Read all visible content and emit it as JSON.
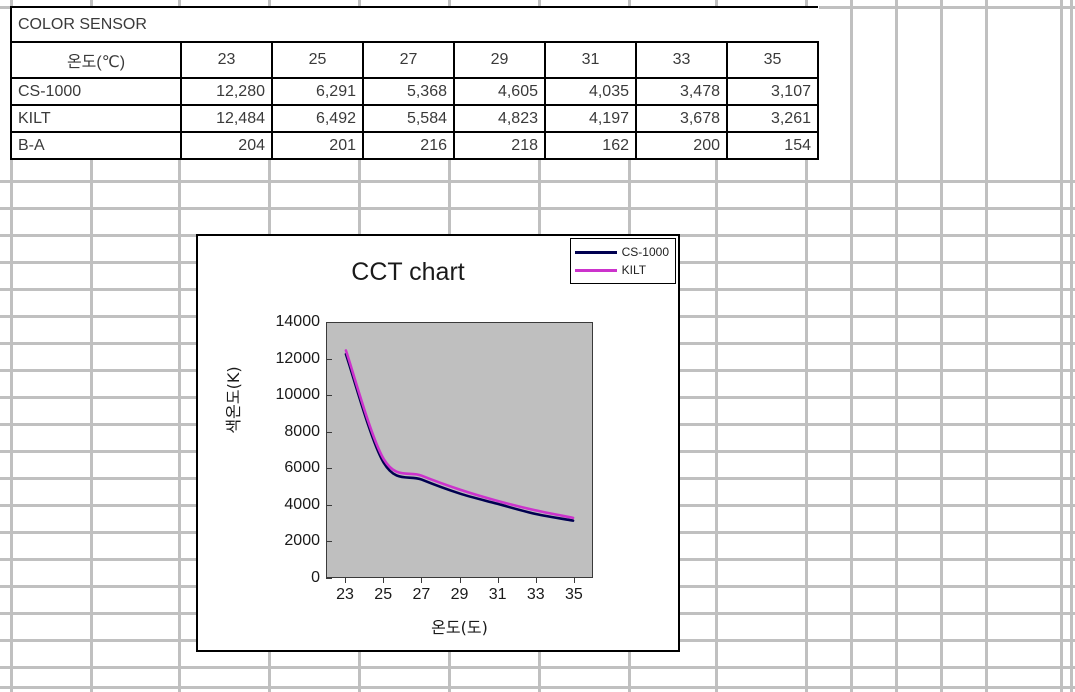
{
  "sheet": {
    "column_edges": [
      10,
      90,
      178,
      268,
      358,
      448,
      538,
      628,
      715,
      805,
      850,
      895,
      940,
      985,
      1060,
      1070
    ],
    "row_edges": [
      6,
      180,
      207,
      234,
      261,
      288,
      315,
      342,
      369,
      396,
      423,
      450,
      477,
      504,
      531,
      558,
      585,
      612,
      639,
      666,
      686
    ],
    "gridline_color": "#c0c0c0"
  },
  "table": {
    "title": "COLOR SENSOR",
    "header_label": "온도(℃)",
    "columns": [
      "23",
      "25",
      "27",
      "29",
      "31",
      "33",
      "35"
    ],
    "rows": [
      {
        "name": "CS-1000",
        "values": [
          "12,280",
          "6,291",
          "5,368",
          "4,605",
          "4,035",
          "3,478",
          "3,107"
        ]
      },
      {
        "name": "KILT",
        "values": [
          "12,484",
          "6,492",
          "5,584",
          "4,823",
          "4,197",
          "3,678",
          "3,261"
        ]
      },
      {
        "name": "B-A",
        "values": [
          "204",
          "201",
          "216",
          "218",
          "162",
          "200",
          "154"
        ]
      }
    ]
  },
  "chart_data": {
    "type": "line",
    "title": "CCT chart",
    "xlabel": "온도(도)",
    "ylabel": "색온도(K)",
    "categories": [
      23,
      25,
      27,
      29,
      31,
      33,
      35
    ],
    "xtick_labels": [
      "23",
      "25",
      "27",
      "29",
      "31",
      "33",
      "35"
    ],
    "ytick_labels": [
      "0",
      "2000",
      "4000",
      "6000",
      "8000",
      "10000",
      "12000",
      "14000"
    ],
    "ytick_values": [
      0,
      2000,
      4000,
      6000,
      8000,
      10000,
      12000,
      14000
    ],
    "ylim": [
      0,
      14000
    ],
    "grid": false,
    "legend_position": "top-right",
    "plot_background": "#bfbfbf",
    "smoothed": true,
    "series": [
      {
        "name": "CS-1000",
        "color": "#000050",
        "values": [
          12280,
          6291,
          5368,
          4605,
          4035,
          3478,
          3107
        ]
      },
      {
        "name": "KILT",
        "color": "#cc33cc",
        "values": [
          12484,
          6492,
          5584,
          4823,
          4197,
          3678,
          3261
        ]
      }
    ]
  }
}
